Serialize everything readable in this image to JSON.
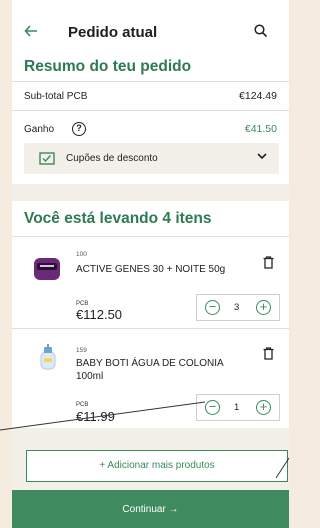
{
  "header": {
    "title": "Pedido atual",
    "back_icon": "arrow-left-icon",
    "search_icon": "search-icon"
  },
  "summary": {
    "title": "Resumo do teu pedido",
    "subtotal_label": "Sub-total PCB",
    "subtotal_value": "€124.49",
    "gain_label": "Ganho",
    "gain_value": "€41.50",
    "coupon_label": "Cupões de desconto"
  },
  "items_title": "Você está levando 4 itens",
  "items": [
    {
      "code": "100",
      "name": "ACTIVE GENES 30 + NOITE 50g",
      "price_label": "PCB",
      "price": "€112.50",
      "qty": "3"
    },
    {
      "code": "159",
      "name": "BABY BOTI ÁGUA DE COLONIA 100ml",
      "price_label": "PCB",
      "price": "€11.99",
      "qty": "1"
    }
  ],
  "add_more_label": "+ Adicionar mais produtos",
  "continue_label": "Continuar →",
  "colors": {
    "accent": "#3f8a5f",
    "background": "#f5ecdf"
  }
}
